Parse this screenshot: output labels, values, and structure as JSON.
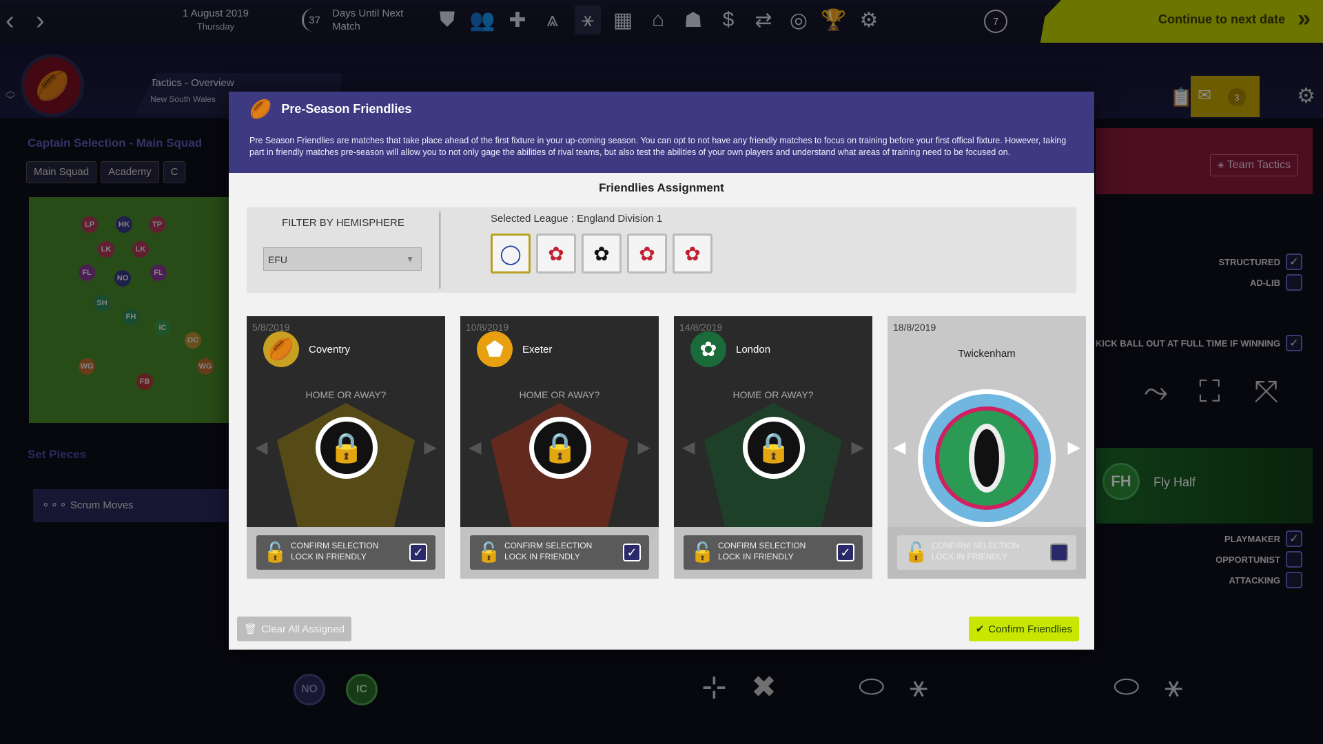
{
  "topbar": {
    "back_icon": "chevron-left-icon",
    "forward_icon": "chevron-right-icon",
    "date": "1 August 2019",
    "weekday": "Thursday",
    "days_until": "37",
    "days_label_1": "Days Until Next",
    "days_label_2": "Match",
    "help_label": "7",
    "continue_label": "Continue to next date",
    "continue_arrow": "»"
  },
  "header": {
    "crumb_title": "Tactics - Overview",
    "crumb_sub": "New South Wales",
    "inbox_count": "3"
  },
  "left": {
    "captain_title": "Captain Selection - Main Squad",
    "tabs": [
      "Main Squad",
      "Academy",
      "C"
    ],
    "set_pieces": "Set Pieces",
    "scrum_moves": "Scrum Moves",
    "players": [
      "LP",
      "HK",
      "TP",
      "LK",
      "LK",
      "FL",
      "NO",
      "FL",
      "SH",
      "FH",
      "IC",
      "OC",
      "WG",
      "WG",
      "FB"
    ]
  },
  "right": {
    "team_tactics": "Team Tactics",
    "structured": "STRUCTURED",
    "adlib": "AD-LIB",
    "kick_ball": "KICK BALL OUT AT FULL TIME IF WINNING",
    "fly_half_badge": "FH",
    "fly_half": "Fly Half",
    "playmaker": "PLAYMAKER",
    "opportunist": "OPPORTUNIST",
    "attacking": "ATTACKING"
  },
  "bottom": {
    "no_badge": "NO",
    "ic_badge": "IC"
  },
  "modal": {
    "title": "Pre-Season Friendlies",
    "description": "Pre Season Friendlies are matches that take place ahead of the first fixture in your up-coming season. You can opt to not have any friendly matches to focus on training before your first offical fixture. However, taking part in friendly matches pre-season will allow you to not only gage the abilities of rival teams, but also test the abilities of your own players and understand what areas of training need to be focused on.",
    "assignment_title": "Friendlies Assignment",
    "filter_label": "FILTER BY HEMISPHERE",
    "filter_value": "EFU",
    "selected_league_label": "Selected League :",
    "selected_league": "England Division 1",
    "home_away": "HOME OR AWAY?",
    "confirm_line1": "CONFIRM SELECTION",
    "confirm_line2": "LOCK IN FRIENDLY",
    "clear_label": "Clear All Assigned",
    "confirm_label": "Confirm Friendlies",
    "fixtures": [
      {
        "date": "5/8/2019",
        "team": "Coventry",
        "checked": "✓"
      },
      {
        "date": "10/8/2019",
        "team": "Exeter",
        "checked": "✓"
      },
      {
        "date": "14/8/2019",
        "team": "London",
        "checked": "✓"
      },
      {
        "date": "18/8/2019",
        "team": "Twickenham",
        "checked": ""
      }
    ]
  },
  "colors": {
    "accent": "#c4d600",
    "modal_header": "#3e3a82",
    "team_tactics_bg": "#8a1a3d"
  }
}
